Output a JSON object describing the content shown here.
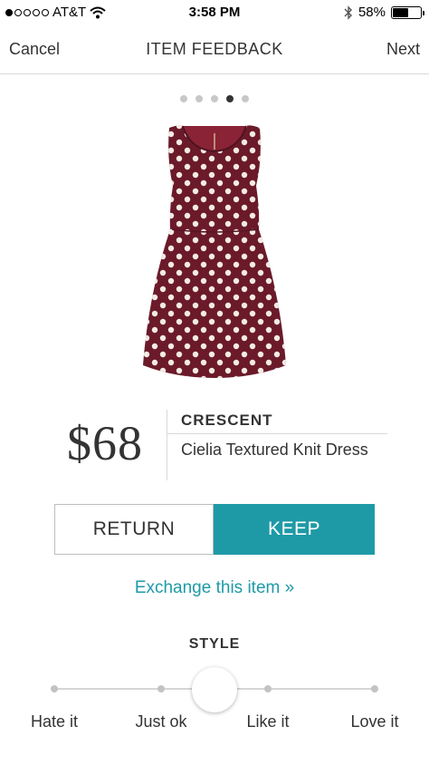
{
  "status_bar": {
    "carrier": "AT&T",
    "time": "3:58 PM",
    "battery": "58%",
    "battery_level": 0.58,
    "icons": [
      "signal-dots-icon",
      "wifi-icon",
      "bluetooth-icon",
      "battery-icon"
    ]
  },
  "nav": {
    "cancel_label": "Cancel",
    "title": "ITEM FEEDBACK",
    "next_label": "Next"
  },
  "pager": {
    "count": 5,
    "active_index": 3
  },
  "product": {
    "price": "$68",
    "brand": "CRESCENT",
    "name": "Cielia Textured Knit Dress",
    "colors": {
      "dress": "#6b1a2a",
      "dots": "#f3ece4"
    }
  },
  "actions": {
    "return_label": "RETURN",
    "keep_label": "KEEP",
    "keep_color": "#1e9aa6",
    "exchange_label": "Exchange this item »"
  },
  "style": {
    "title": "STYLE",
    "options": [
      "Hate it",
      "Just ok",
      "Like it",
      "Love it"
    ],
    "selected_position": 0.5
  }
}
